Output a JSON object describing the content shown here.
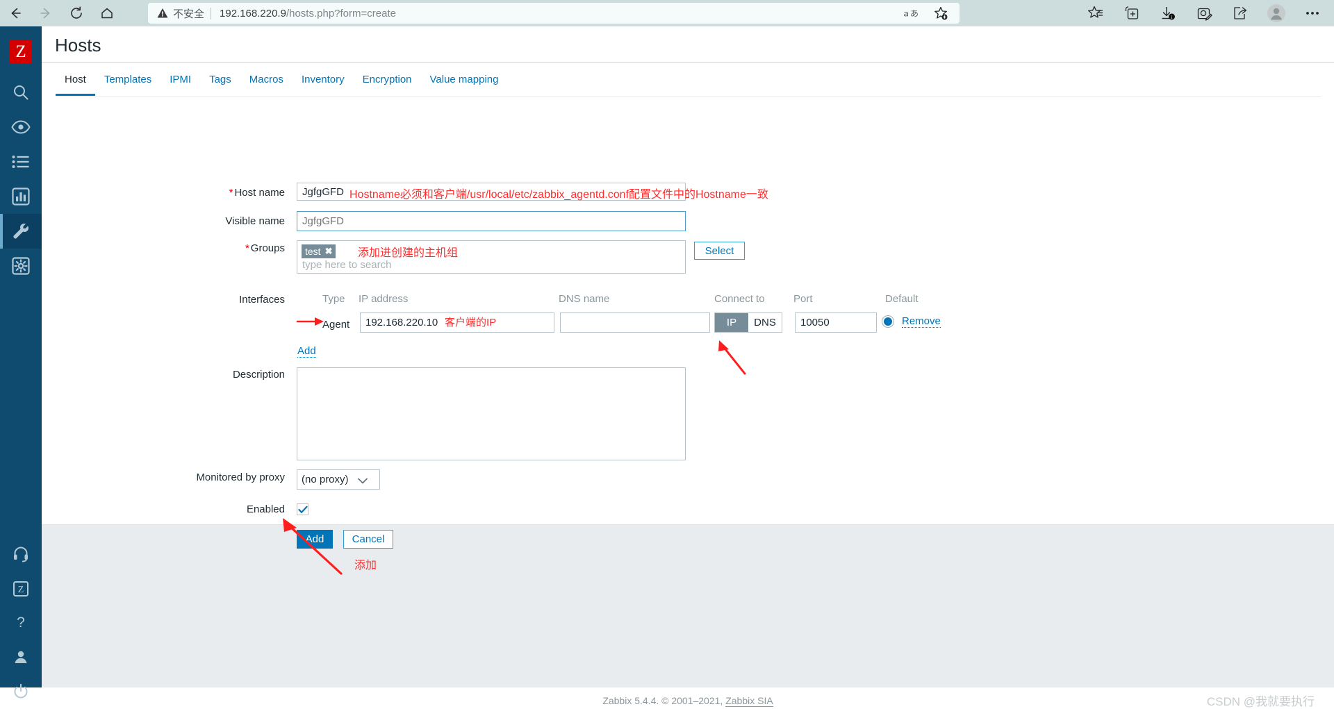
{
  "browser": {
    "nav": {
      "back": "back-arrow",
      "forward": "forward-arrow",
      "reload": "reload",
      "home": "home"
    },
    "security_label": "不安全",
    "url_host": "192.168.220.9",
    "url_path": "/hosts.php?form=create",
    "url_full": "192.168.220.9/hosts.php?form=create",
    "toolbar_icons": [
      "read-aloud-icon",
      "add-favorite-icon",
      "favorites-icon",
      "collections-icon",
      "downloads-icon",
      "web-capture-icon",
      "share-icon",
      "profile-avatar",
      "more-options-icon"
    ]
  },
  "sidebar": {
    "logo": "Z",
    "items": [
      {
        "name": "search-icon",
        "active": false
      },
      {
        "name": "monitoring-eye-icon",
        "active": false
      },
      {
        "name": "services-list-icon",
        "active": false
      },
      {
        "name": "inventory-reports-icon",
        "active": false
      },
      {
        "name": "configuration-wrench-icon",
        "active": true
      },
      {
        "name": "administration-gear-icon",
        "active": false
      },
      {
        "name": "support-headset-icon",
        "active": false
      },
      {
        "name": "zabbix-share-icon",
        "active": false
      },
      {
        "name": "help-question-icon",
        "active": false
      },
      {
        "name": "user-profile-icon",
        "active": false
      },
      {
        "name": "sign-out-power-icon",
        "active": false
      }
    ]
  },
  "page": {
    "title": "Hosts"
  },
  "tabs": [
    {
      "label": "Host",
      "active": true
    },
    {
      "label": "Templates",
      "active": false
    },
    {
      "label": "IPMI",
      "active": false
    },
    {
      "label": "Tags",
      "active": false
    },
    {
      "label": "Macros",
      "active": false
    },
    {
      "label": "Inventory",
      "active": false
    },
    {
      "label": "Encryption",
      "active": false
    },
    {
      "label": "Value mapping",
      "active": false
    }
  ],
  "form": {
    "host_name": {
      "label": "Host name",
      "required": true,
      "value": "JgfgGFD"
    },
    "visible_name": {
      "label": "Visible name",
      "required": false,
      "value": "",
      "placeholder": "JgfgGFD"
    },
    "groups": {
      "label": "Groups",
      "required": true,
      "chip": "test",
      "chip_remove": "✖",
      "search_placeholder": "type here to search",
      "select_button": "Select"
    },
    "interfaces": {
      "label": "Interfaces",
      "headers": {
        "type": "Type",
        "ip_address": "IP address",
        "dns_name": "DNS name",
        "connect_to": "Connect to",
        "port": "Port",
        "default": "Default"
      },
      "rows": [
        {
          "type": "Agent",
          "ip": "192.168.220.10",
          "dns": "",
          "connect_to_ip": "IP",
          "connect_to_dns": "DNS",
          "connect_to_selected": "IP",
          "port": "10050",
          "default_selected": true,
          "remove_label": "Remove"
        }
      ],
      "add_link": "Add"
    },
    "description": {
      "label": "Description",
      "value": ""
    },
    "monitored_by_proxy": {
      "label": "Monitored by proxy",
      "value": "(no proxy)",
      "options": [
        "(no proxy)"
      ]
    },
    "enabled": {
      "label": "Enabled",
      "checked": true
    },
    "buttons": {
      "submit": "Add",
      "cancel": "Cancel"
    }
  },
  "annotations": {
    "hostname_note": "Hostname必须和客户端/usr/local/etc/zabbix_agentd.conf配置文件中的Hostname一致",
    "groups_note": "添加进创建的主机组",
    "ip_note": "客户端的IP",
    "add_note": "添加"
  },
  "footer": {
    "text_prefix": "Zabbix 5.4.4. © 2001–2021, ",
    "link": "Zabbix SIA",
    "watermark": "CSDN @我就要执行"
  },
  "colors": {
    "brand_red": "#d40000",
    "sidebar_bg": "#0f4b6e",
    "accent_blue": "#0275b8",
    "annotation_red": "#ff2d2d",
    "browser_chrome": "#cdddde"
  }
}
